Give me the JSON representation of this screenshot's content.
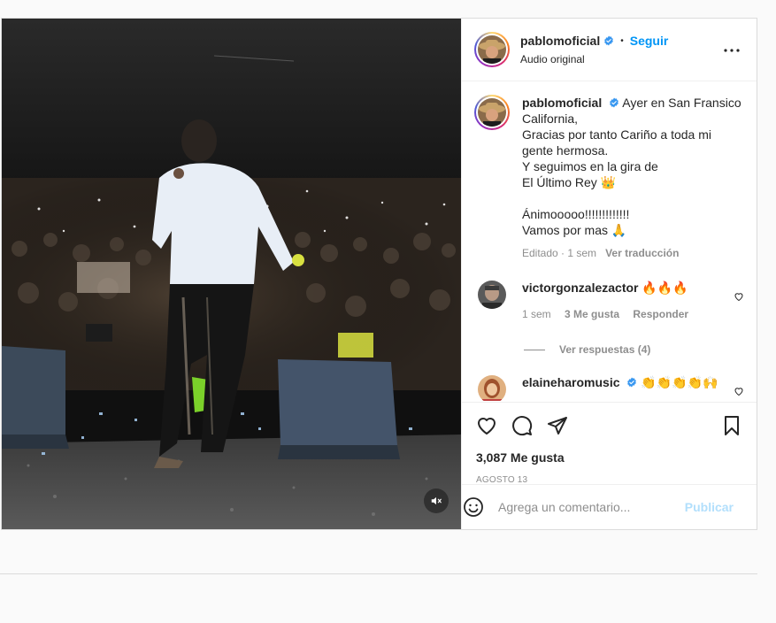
{
  "post": {
    "author": {
      "username": "pablomoficial",
      "audio": "Audio original",
      "follow_label": "Seguir",
      "verified": true
    },
    "caption": {
      "username": "pablomoficial",
      "lines": [
        "Ayer en San Fransico",
        "California,",
        "Gracias por tanto Cariño a toda mi",
        "gente hermosa.",
        "Y seguimos en la gira de",
        "El Último Rey 👑",
        "",
        "Ánimooooo!!!!!!!!!!!!!",
        "Vamos por mas 🙏"
      ],
      "edited": "Editado",
      "time": "1 sem",
      "translate": "Ver traducción"
    },
    "comments": [
      {
        "username": "victorgonzalezactor",
        "text": "🔥🔥🔥",
        "time": "1 sem",
        "likes": "3 Me gusta",
        "reply": "Responder",
        "view_replies": "Ver respuestas (4)"
      },
      {
        "username": "elaineharomusic",
        "text": "👏👏👏👏🙌",
        "verified": true
      }
    ],
    "likes": "3,087 Me gusta",
    "date": "AGOSTO 13",
    "add_comment": {
      "placeholder": "Agrega un comentario...",
      "publish_label": "Publicar"
    }
  },
  "icons": {
    "mute": "speaker-muted-icon",
    "more": "more-options-icon",
    "like": "heart-icon",
    "comment": "comment-bubble-icon",
    "share": "paper-plane-icon",
    "save": "bookmark-icon",
    "emoji": "emoji-smile-icon"
  },
  "colors": {
    "link": "#0095f6",
    "verified": "#3897f0",
    "muted_text": "#8e8e8e",
    "publish_disabled": "#b2dffc"
  }
}
